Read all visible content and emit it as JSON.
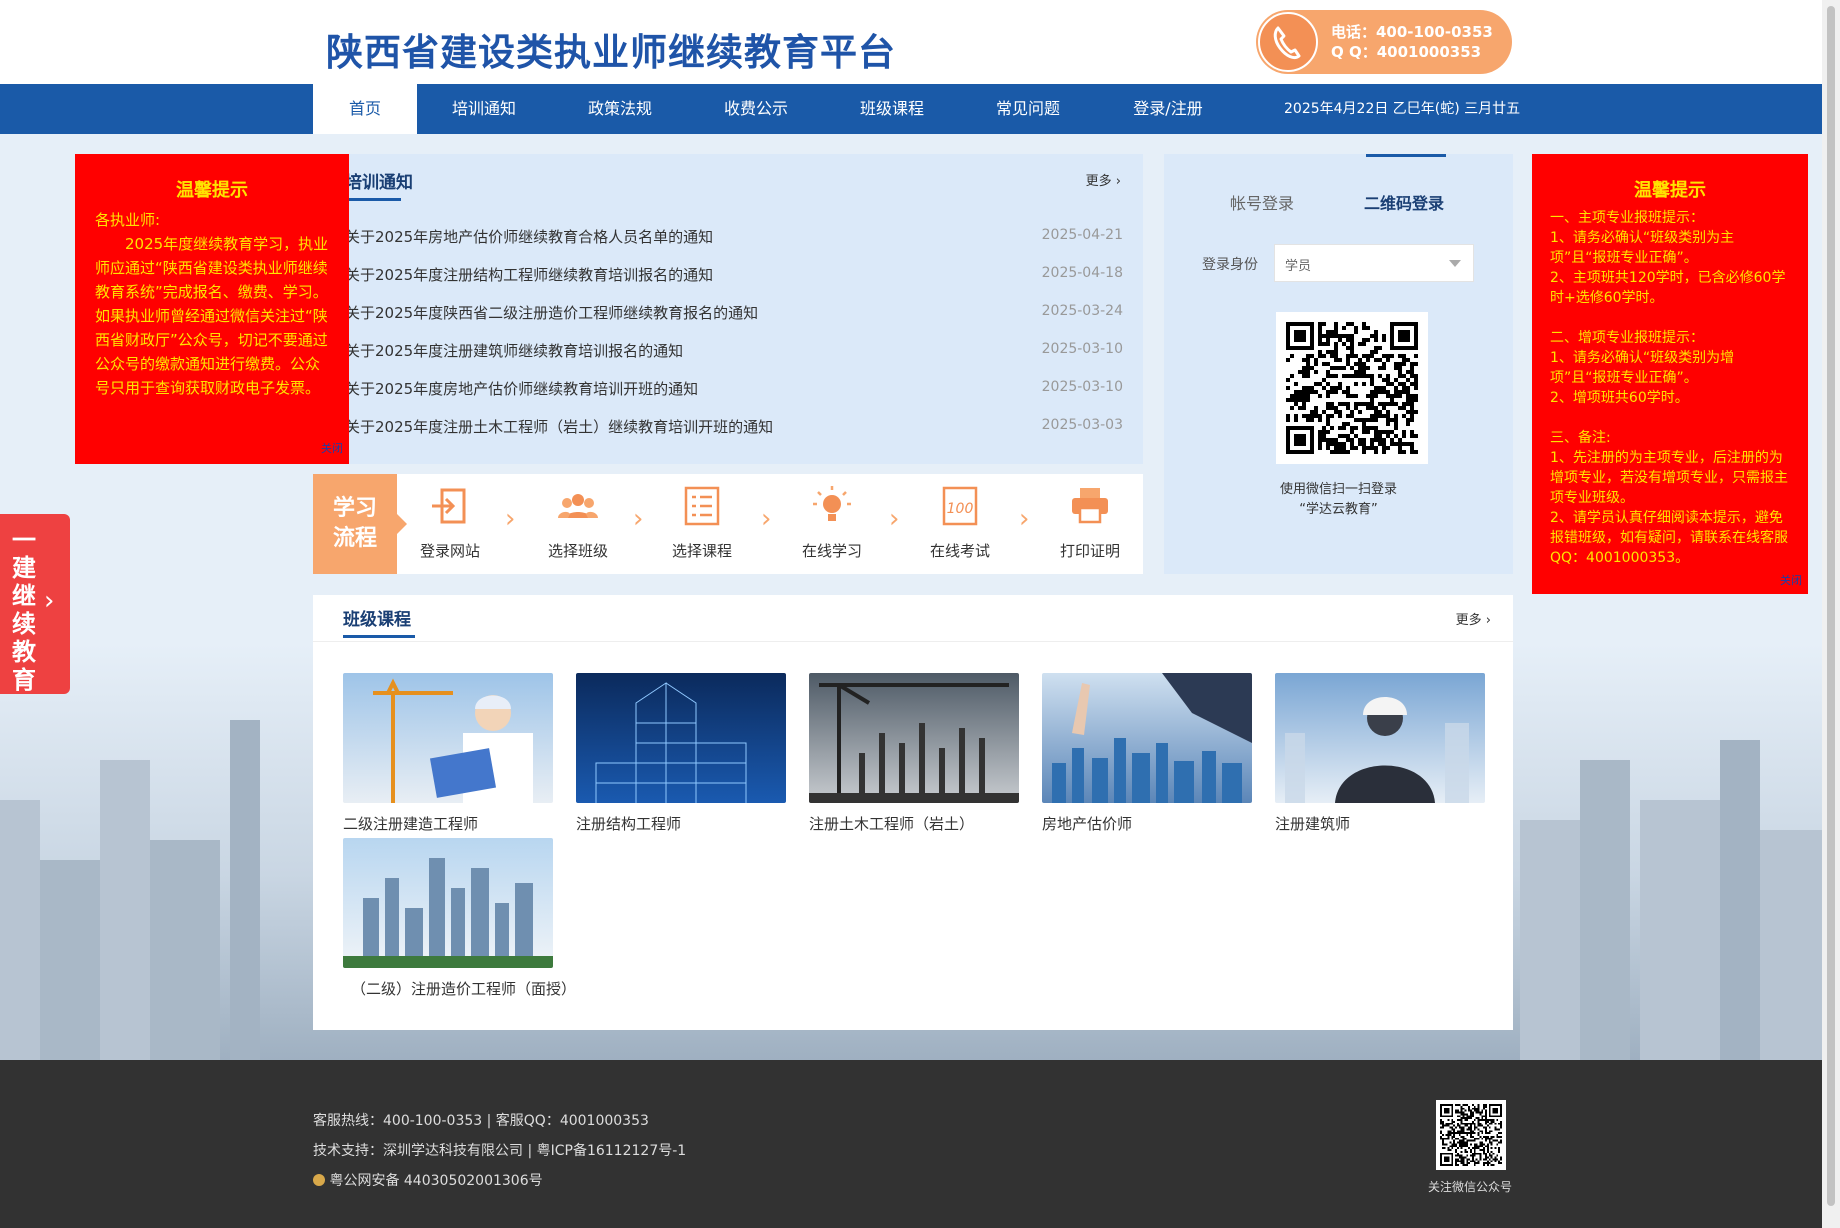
{
  "header": {
    "site_title": "陕西省建设类执业师继续教育平台",
    "hotline_phone": "电话：400-100-0353",
    "hotline_qq": "Q  Q：4001000353"
  },
  "nav": {
    "items": [
      {
        "label": "首页",
        "active": true
      },
      {
        "label": "培训通知"
      },
      {
        "label": "政策法规"
      },
      {
        "label": "收费公示"
      },
      {
        "label": "班级课程"
      },
      {
        "label": "常见问题"
      },
      {
        "label": "登录/注册"
      }
    ],
    "date": "2025年4月22日 乙巳年(蛇) 三月廿五"
  },
  "notice": {
    "title": "培训通知",
    "more": "更多",
    "items": [
      {
        "text": "关于2025年房地产估价师继续教育合格人员名单的通知",
        "date": "2025-04-21"
      },
      {
        "text": "关于2025年度注册结构工程师继续教育培训报名的通知",
        "date": "2025-04-18"
      },
      {
        "text": "关于2025年度陕西省二级注册造价工程师继续教育报名的通知",
        "date": "2025-03-24"
      },
      {
        "text": "关于2025年度注册建筑师继续教育培训报名的通知",
        "date": "2025-03-10"
      },
      {
        "text": "关于2025年度房地产估价师继续教育培训开班的通知",
        "date": "2025-03-10"
      },
      {
        "text": "关于2025年度注册土木工程师（岩土）继续教育培训开班的通知",
        "date": "2025-03-03"
      }
    ]
  },
  "flow": {
    "label_line1": "学习",
    "label_line2": "流程",
    "steps": [
      {
        "label": "登录网站",
        "icon": "login-icon"
      },
      {
        "label": "选择班级",
        "icon": "group-icon"
      },
      {
        "label": "选择课程",
        "icon": "list-icon"
      },
      {
        "label": "在线学习",
        "icon": "lightbulb-icon"
      },
      {
        "label": "在线考试",
        "icon": "exam-icon"
      },
      {
        "label": "打印证明",
        "icon": "printer-icon"
      }
    ],
    "accent": "#f7a66d"
  },
  "login": {
    "tab_account": "帐号登录",
    "tab_qr": "二维码登录",
    "identity_label": "登录身份",
    "identity_value": "学员",
    "qr_caption_1": "使用微信扫一扫登录",
    "qr_caption_2": "“学达云教育”"
  },
  "popup_left": {
    "title": "温馨提示",
    "greeting": "各执业师:",
    "body": "2025年度继续教育学习，执业师应通过“陕西省建设类执业师继续教育系统”完成报名、缴费、学习。如果执业师曾经通过微信关注过“陕西省财政厅”公众号，切记不要通过公众号的缴款通知进行缴费。公众号只用于查询获取财政电子发票。",
    "close": "关闭"
  },
  "popup_right": {
    "title": "温馨提示",
    "lines": [
      "一、主项专业报班提示：",
      "1、请务必确认“班级类别为主项”且“报班专业正确”。",
      "2、主项班共120学时，已含必修60学时+选修60学时。",
      "",
      "二、增项专业报班提示：",
      "1、请务必确认“班级类别为增项”且“报班专业正确”。",
      "2、增项班共60学时。",
      "",
      "三、备注:",
      "1、先注册的为主项专业，后注册的为增项专业，若没有增项专业，只需报主项专业班级。",
      "2、请学员认真仔细阅读本提示，避免报错班级，如有疑问，请联系在线客服QQ：4001000353。"
    ],
    "close": "关闭"
  },
  "side_tab": {
    "text": "一建继续教育"
  },
  "courses": {
    "title": "班级课程",
    "more": "更多",
    "items": [
      {
        "name": "二级注册建造工程师"
      },
      {
        "name": "注册结构工程师"
      },
      {
        "name": "注册土木工程师（岩土）"
      },
      {
        "name": "房地产估价师"
      },
      {
        "name": "注册建筑师"
      },
      {
        "name": "（二级）注册造价工程师（面授）"
      }
    ]
  },
  "footer": {
    "hotline": "客服热线：400-100-0353    |    客服QQ：4001000353",
    "support": "技术支持：深圳学达科技有限公司    |    粤ICP备16112127号-1",
    "police": "粤公网安备 44030502001306号",
    "qr_caption": "关注微信公众号"
  },
  "colors": {
    "brand_blue": "#1a5aa8",
    "popup_red": "#ff0000",
    "popup_text": "#ffe300"
  }
}
